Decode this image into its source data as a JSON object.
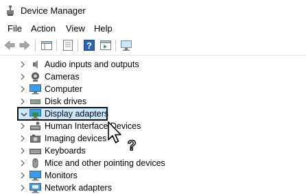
{
  "window": {
    "title": "Device Manager"
  },
  "menubar": [
    {
      "id": "file",
      "label": "File"
    },
    {
      "id": "action",
      "label": "Action"
    },
    {
      "id": "view",
      "label": "View"
    },
    {
      "id": "help",
      "label": "Help"
    }
  ],
  "toolbar": [
    {
      "icon": "back-arrow-icon"
    },
    {
      "icon": "forward-arrow-icon"
    },
    {
      "icon": "show-hide-console-tree-icon"
    },
    {
      "icon": "properties-icon"
    },
    {
      "icon": "help-icon"
    },
    {
      "icon": "action-pane-icon"
    },
    {
      "icon": "scan-hardware-icon"
    }
  ],
  "tree": {
    "items": [
      {
        "label": "Audio inputs and outputs",
        "icon": "speaker-icon",
        "expanded": false
      },
      {
        "label": "Cameras",
        "icon": "camera-icon",
        "expanded": false
      },
      {
        "label": "Computer",
        "icon": "monitor-icon",
        "expanded": false
      },
      {
        "label": "Disk drives",
        "icon": "disk-drive-icon",
        "expanded": false
      },
      {
        "label": "Display adapters",
        "icon": "display-adapter-icon",
        "expanded": true,
        "selected": true
      },
      {
        "label": "Human Interface Devices",
        "icon": "hid-icon",
        "expanded": false
      },
      {
        "label": "Imaging devices",
        "icon": "imaging-device-icon",
        "expanded": false
      },
      {
        "label": "Keyboards",
        "icon": "keyboard-icon",
        "expanded": false
      },
      {
        "label": "Mice and other pointing devices",
        "icon": "mouse-icon",
        "expanded": false
      },
      {
        "label": "Monitors",
        "icon": "monitor-icon",
        "expanded": false
      },
      {
        "label": "Network adapters",
        "icon": "network-adapter-icon",
        "expanded": false
      }
    ]
  },
  "cursor": {
    "icon": "help-select-cursor-icon"
  },
  "colors": {
    "selection_fill": "#cce8ff",
    "highlight_border": "#111111",
    "icon_blue": "#1e88e5"
  }
}
